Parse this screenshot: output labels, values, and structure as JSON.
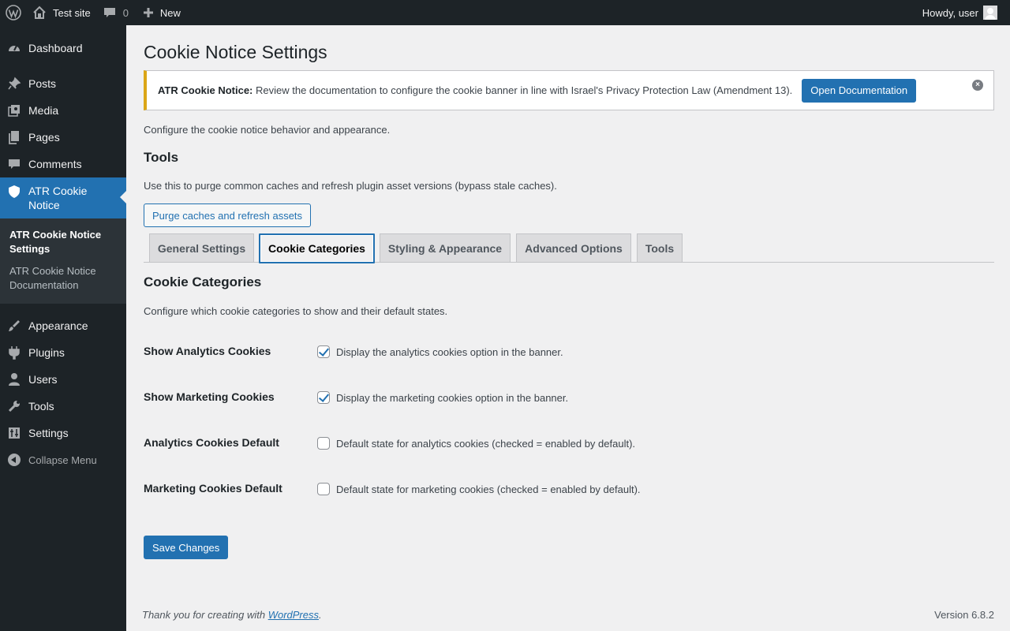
{
  "adminbar": {
    "site_name": "Test site",
    "comments_count": "0",
    "new_label": "New",
    "howdy": "Howdy, user"
  },
  "sidebar": {
    "items": [
      {
        "label": "Dashboard",
        "icon": "dashboard-icon"
      },
      {
        "label": "Posts",
        "icon": "pushpin-icon"
      },
      {
        "label": "Media",
        "icon": "media-icon"
      },
      {
        "label": "Pages",
        "icon": "pages-icon"
      },
      {
        "label": "Comments",
        "icon": "comment-icon"
      },
      {
        "label": "ATR Cookie Notice",
        "icon": "shield-icon"
      },
      {
        "label": "Appearance",
        "icon": "paintbrush-icon"
      },
      {
        "label": "Plugins",
        "icon": "plugin-icon"
      },
      {
        "label": "Users",
        "icon": "user-icon"
      },
      {
        "label": "Tools",
        "icon": "wrench-icon"
      },
      {
        "label": "Settings",
        "icon": "settings-icon"
      }
    ],
    "submenu": [
      "ATR Cookie Notice Settings",
      "ATR Cookie Notice Documentation"
    ],
    "collapse_label": "Collapse Menu"
  },
  "page": {
    "title": "Cookie Notice Settings",
    "notice": {
      "bold": "ATR Cookie Notice:",
      "text": " Review the documentation to configure the cookie banner in line with Israel's Privacy Protection Law (Amendment 13).",
      "button": "Open Documentation",
      "dismiss": "×"
    },
    "intro": "Configure the cookie notice behavior and appearance.",
    "tools_heading": "Tools",
    "tools_desc": "Use this to purge common caches and refresh plugin asset versions (bypass stale caches).",
    "purge_button": "Purge caches and refresh assets",
    "tabs": [
      "General Settings",
      "Cookie Categories",
      "Styling & Appearance",
      "Advanced Options",
      "Tools"
    ],
    "active_tab": "Cookie Categories",
    "section_heading": "Cookie Categories",
    "section_desc": "Configure which cookie categories to show and their default states.",
    "fields": [
      {
        "label": "Show Analytics Cookies",
        "description": "Display the analytics cookies option in the banner.",
        "checked": true
      },
      {
        "label": "Show Marketing Cookies",
        "description": "Display the marketing cookies option in the banner.",
        "checked": true
      },
      {
        "label": "Analytics Cookies Default",
        "description": "Default state for analytics cookies (checked = enabled by default).",
        "checked": false
      },
      {
        "label": "Marketing Cookies Default",
        "description": "Default state for marketing cookies (checked = enabled by default).",
        "checked": false
      }
    ],
    "save_button": "Save Changes"
  },
  "footer": {
    "thanks_prefix": "Thank you for creating with ",
    "link": "WordPress",
    "suffix": ".",
    "version": "Version 6.8.2"
  },
  "colors": {
    "accent": "#2271b1",
    "notice_border": "#dba617",
    "sidebar_bg": "#1d2327"
  }
}
